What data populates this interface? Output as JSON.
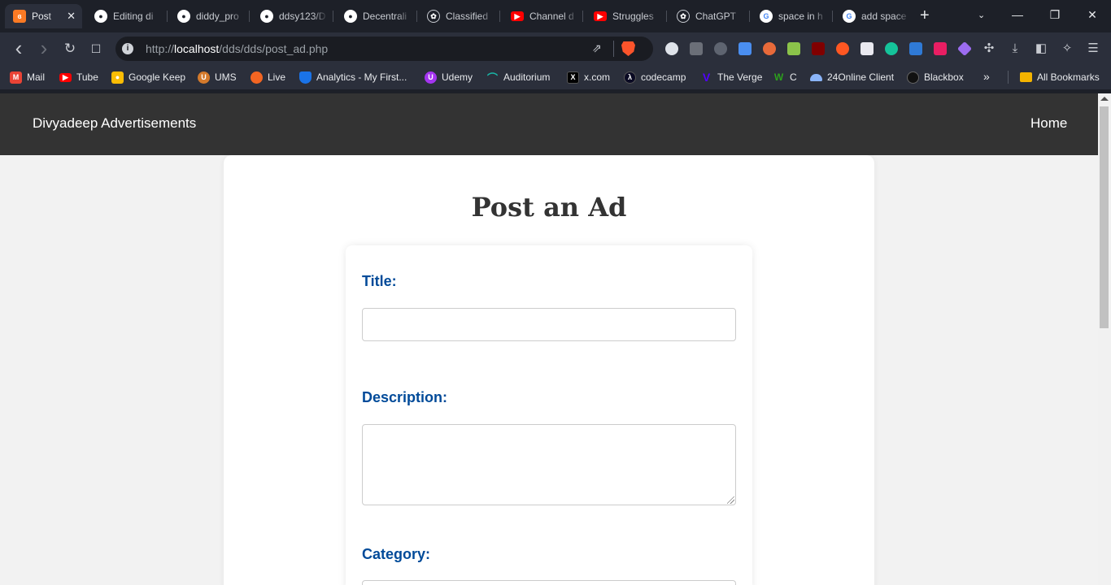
{
  "browser": {
    "tabs": [
      {
        "label": "Post",
        "icon": "xampp-icon",
        "color": "#fb7a24",
        "active": true
      },
      {
        "label": "Editing di",
        "icon": "github-icon",
        "color": "#ffffff"
      },
      {
        "label": "diddy_pro",
        "icon": "github-icon",
        "color": "#ffffff"
      },
      {
        "label": "ddsy123/D",
        "icon": "github-icon",
        "color": "#ffffff"
      },
      {
        "label": "Decentrali",
        "icon": "github-icon",
        "color": "#ffffff"
      },
      {
        "label": "Classified",
        "icon": "openai-icon",
        "color": "#ffffff"
      },
      {
        "label": "Channel d",
        "icon": "youtube-icon",
        "color": "#ff0000"
      },
      {
        "label": "Struggles",
        "icon": "youtube-icon",
        "color": "#ff0000"
      },
      {
        "label": "ChatGPT",
        "icon": "openai-icon",
        "color": "#ffffff"
      },
      {
        "label": "space in h",
        "icon": "google-icon",
        "color": "#4285f4"
      },
      {
        "label": "add space",
        "icon": "google-icon",
        "color": "#4285f4"
      }
    ],
    "new_tab": "+",
    "tab_dropdown": "⌄",
    "window_controls": {
      "minimize": "—",
      "restore": "❐",
      "close": "✕"
    },
    "nav": {
      "back": "‹",
      "forward": "›",
      "reload": "↻",
      "bookmark": "☐"
    },
    "url": {
      "scheme": "http://",
      "host": "localhost",
      "path": "/dds/dds/post_ad.php",
      "info": "i"
    },
    "bookmarks": [
      {
        "label": "Mail",
        "icon": "gmail-icon",
        "color": "#ea4335"
      },
      {
        "label": "Tube",
        "icon": "youtube-icon",
        "color": "#ff0000"
      },
      {
        "label": "Google Keep",
        "icon": "keep-icon",
        "color": "#fbbc04"
      },
      {
        "label": "UMS",
        "icon": "ums-icon",
        "color": "#d47a2c"
      },
      {
        "label": "Live",
        "icon": "basketball-icon",
        "color": "#f26522"
      },
      {
        "label": "Analytics - My First...",
        "icon": "shield-icon",
        "color": "#1a73e8"
      },
      {
        "label": "Udemy",
        "icon": "udemy-icon",
        "color": "#a435f0"
      },
      {
        "label": "Auditorium",
        "icon": "auditorium-icon",
        "color": "#19b5a6"
      },
      {
        "label": "x.com",
        "icon": "x-icon",
        "color": "#000000"
      },
      {
        "label": "codecamp",
        "icon": "freecodecamp-icon",
        "color": "#0a0a23"
      },
      {
        "label": "The Verge",
        "icon": "verge-icon",
        "color": "#5200ff"
      },
      {
        "label": "C",
        "icon": "w-icon",
        "color": "#2ca01c"
      },
      {
        "label": "24Online Client",
        "icon": "cloud-icon",
        "color": "#8ab4f8"
      },
      {
        "label": "Blackbox",
        "icon": "blackbox-icon",
        "color": "#111111"
      }
    ],
    "bookmarks_more": "»",
    "all_bookmarks": "All Bookmarks"
  },
  "page": {
    "brand": "Divyadeep Advertisements",
    "nav_home": "Home",
    "title": "Post an Ad",
    "form": {
      "title_label": "Title:",
      "title_value": "",
      "description_label": "Description:",
      "description_value": "",
      "category_label": "Category:"
    }
  }
}
